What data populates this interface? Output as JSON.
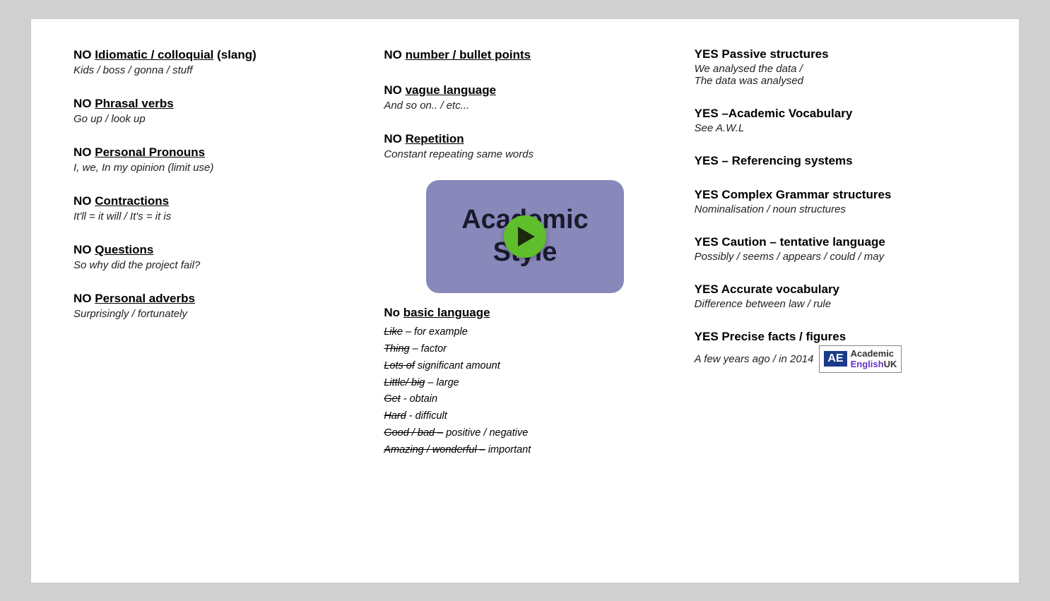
{
  "left_col": {
    "items": [
      {
        "id": "idiomatic",
        "no": "NO",
        "title_underline": "Idiomatic / colloquial",
        "title_rest": " (slang)",
        "sub": "Kids / boss / gonna / stuff"
      },
      {
        "id": "phrasal",
        "no": "NO",
        "title_underline": "Phrasal verbs",
        "title_rest": "",
        "sub": "Go up / look up"
      },
      {
        "id": "pronouns",
        "no": "NO",
        "title_underline": "Personal Pronouns",
        "title_rest": "",
        "sub": "I, we, In my opinion (limit use)"
      },
      {
        "id": "contractions",
        "no": "NO",
        "title_underline": "Contractions",
        "title_rest": "",
        "sub": "It'll = it will / It's = it is"
      },
      {
        "id": "questions",
        "no": "NO",
        "title_underline": "Questions",
        "title_rest": "",
        "sub": "So why did the project fail?"
      },
      {
        "id": "personal_adverbs",
        "no": "NO",
        "title_underline": "Personal adverbs",
        "title_rest": "",
        "sub": "Surprisingly / fortunately"
      }
    ]
  },
  "mid_col": {
    "top_items": [
      {
        "id": "bullet",
        "no": "NO",
        "title_underline": "number / bullet points",
        "title_rest": ""
      },
      {
        "id": "vague",
        "no": "NO",
        "title_underline": "vague language",
        "title_rest": "",
        "sub": "And so on.. / etc..."
      },
      {
        "id": "repetition",
        "no": "NO",
        "title_underline": "Repetition",
        "title_rest": "",
        "sub": "Constant repeating same words"
      }
    ],
    "video": {
      "line1": "Academic",
      "line2": "Style"
    },
    "basic_lang": {
      "title_no": "No",
      "title_underline": "basic language",
      "items": [
        {
          "strikethrough": "Like",
          "rest": " – for example"
        },
        {
          "strikethrough": "Thing",
          "rest": " – factor"
        },
        {
          "strikethrough": "Lots of",
          "rest": " significant amount"
        },
        {
          "strikethrough": "Little/ big",
          "rest": " – large"
        },
        {
          "strikethrough": "Get",
          "rest": " -  obtain"
        },
        {
          "strikethrough": "Hard",
          "rest": " - difficult"
        },
        {
          "strikethrough": "Good / bad –",
          "rest": " positive / negative"
        },
        {
          "strikethrough": "Amazing / wonderful –",
          "rest": " important"
        }
      ]
    }
  },
  "right_col": {
    "items": [
      {
        "id": "passive",
        "yes": "YES",
        "title_rest": " Passive structures",
        "sub": "We analysed the data /\nThe data was analysed"
      },
      {
        "id": "academic_vocab",
        "yes": "YES",
        "title_rest": " –Academic Vocabulary",
        "sub": "See A.W.L"
      },
      {
        "id": "referencing",
        "yes": "YES",
        "title_rest": " – Referencing systems",
        "sub": ""
      },
      {
        "id": "complex_grammar",
        "yes": "YES",
        "title_rest": " Complex Grammar structures",
        "sub": "Nominalisation / noun structures"
      },
      {
        "id": "caution",
        "yes": "YES",
        "title_rest": " Caution – tentative language",
        "sub": "Possibly / seems / appears / could / may"
      },
      {
        "id": "accurate_vocab",
        "yes": "YES",
        "title_rest": " Accurate vocabulary",
        "sub": "Difference between law / rule"
      },
      {
        "id": "precise_facts",
        "yes": "YES",
        "title_rest": " Precise facts / figures",
        "sub": "A few years ago / in 2014"
      }
    ],
    "logo": {
      "ae": "AE",
      "line1": "Academic",
      "line2": "English",
      "line3": "UK"
    }
  }
}
